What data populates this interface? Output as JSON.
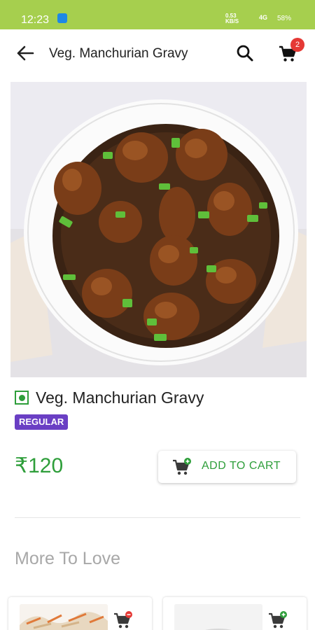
{
  "status_bar": {
    "time": "12:23",
    "network_speed_top": "0.53",
    "network_speed_bottom": "KB/S",
    "signal": "4G",
    "battery": "58%"
  },
  "app_bar": {
    "title": "Veg. Manchurian Gravy",
    "cart_count": "2"
  },
  "product": {
    "name": "Veg. Manchurian Gravy",
    "variant": "REGULAR",
    "price": "₹120",
    "add_to_cart_label": "ADD TO CART",
    "veg": true
  },
  "more_section": {
    "title": "More To Love"
  },
  "colors": {
    "status_bar": "#a6cf4e",
    "accent_green": "#2e9e3a",
    "badge_red": "#e53935",
    "variant_purple": "#6a3fc4"
  },
  "icons": [
    "back-arrow-icon",
    "search-icon",
    "cart-icon",
    "veg-indicator-icon",
    "add-to-cart-icon",
    "remove-from-cart-icon"
  ]
}
